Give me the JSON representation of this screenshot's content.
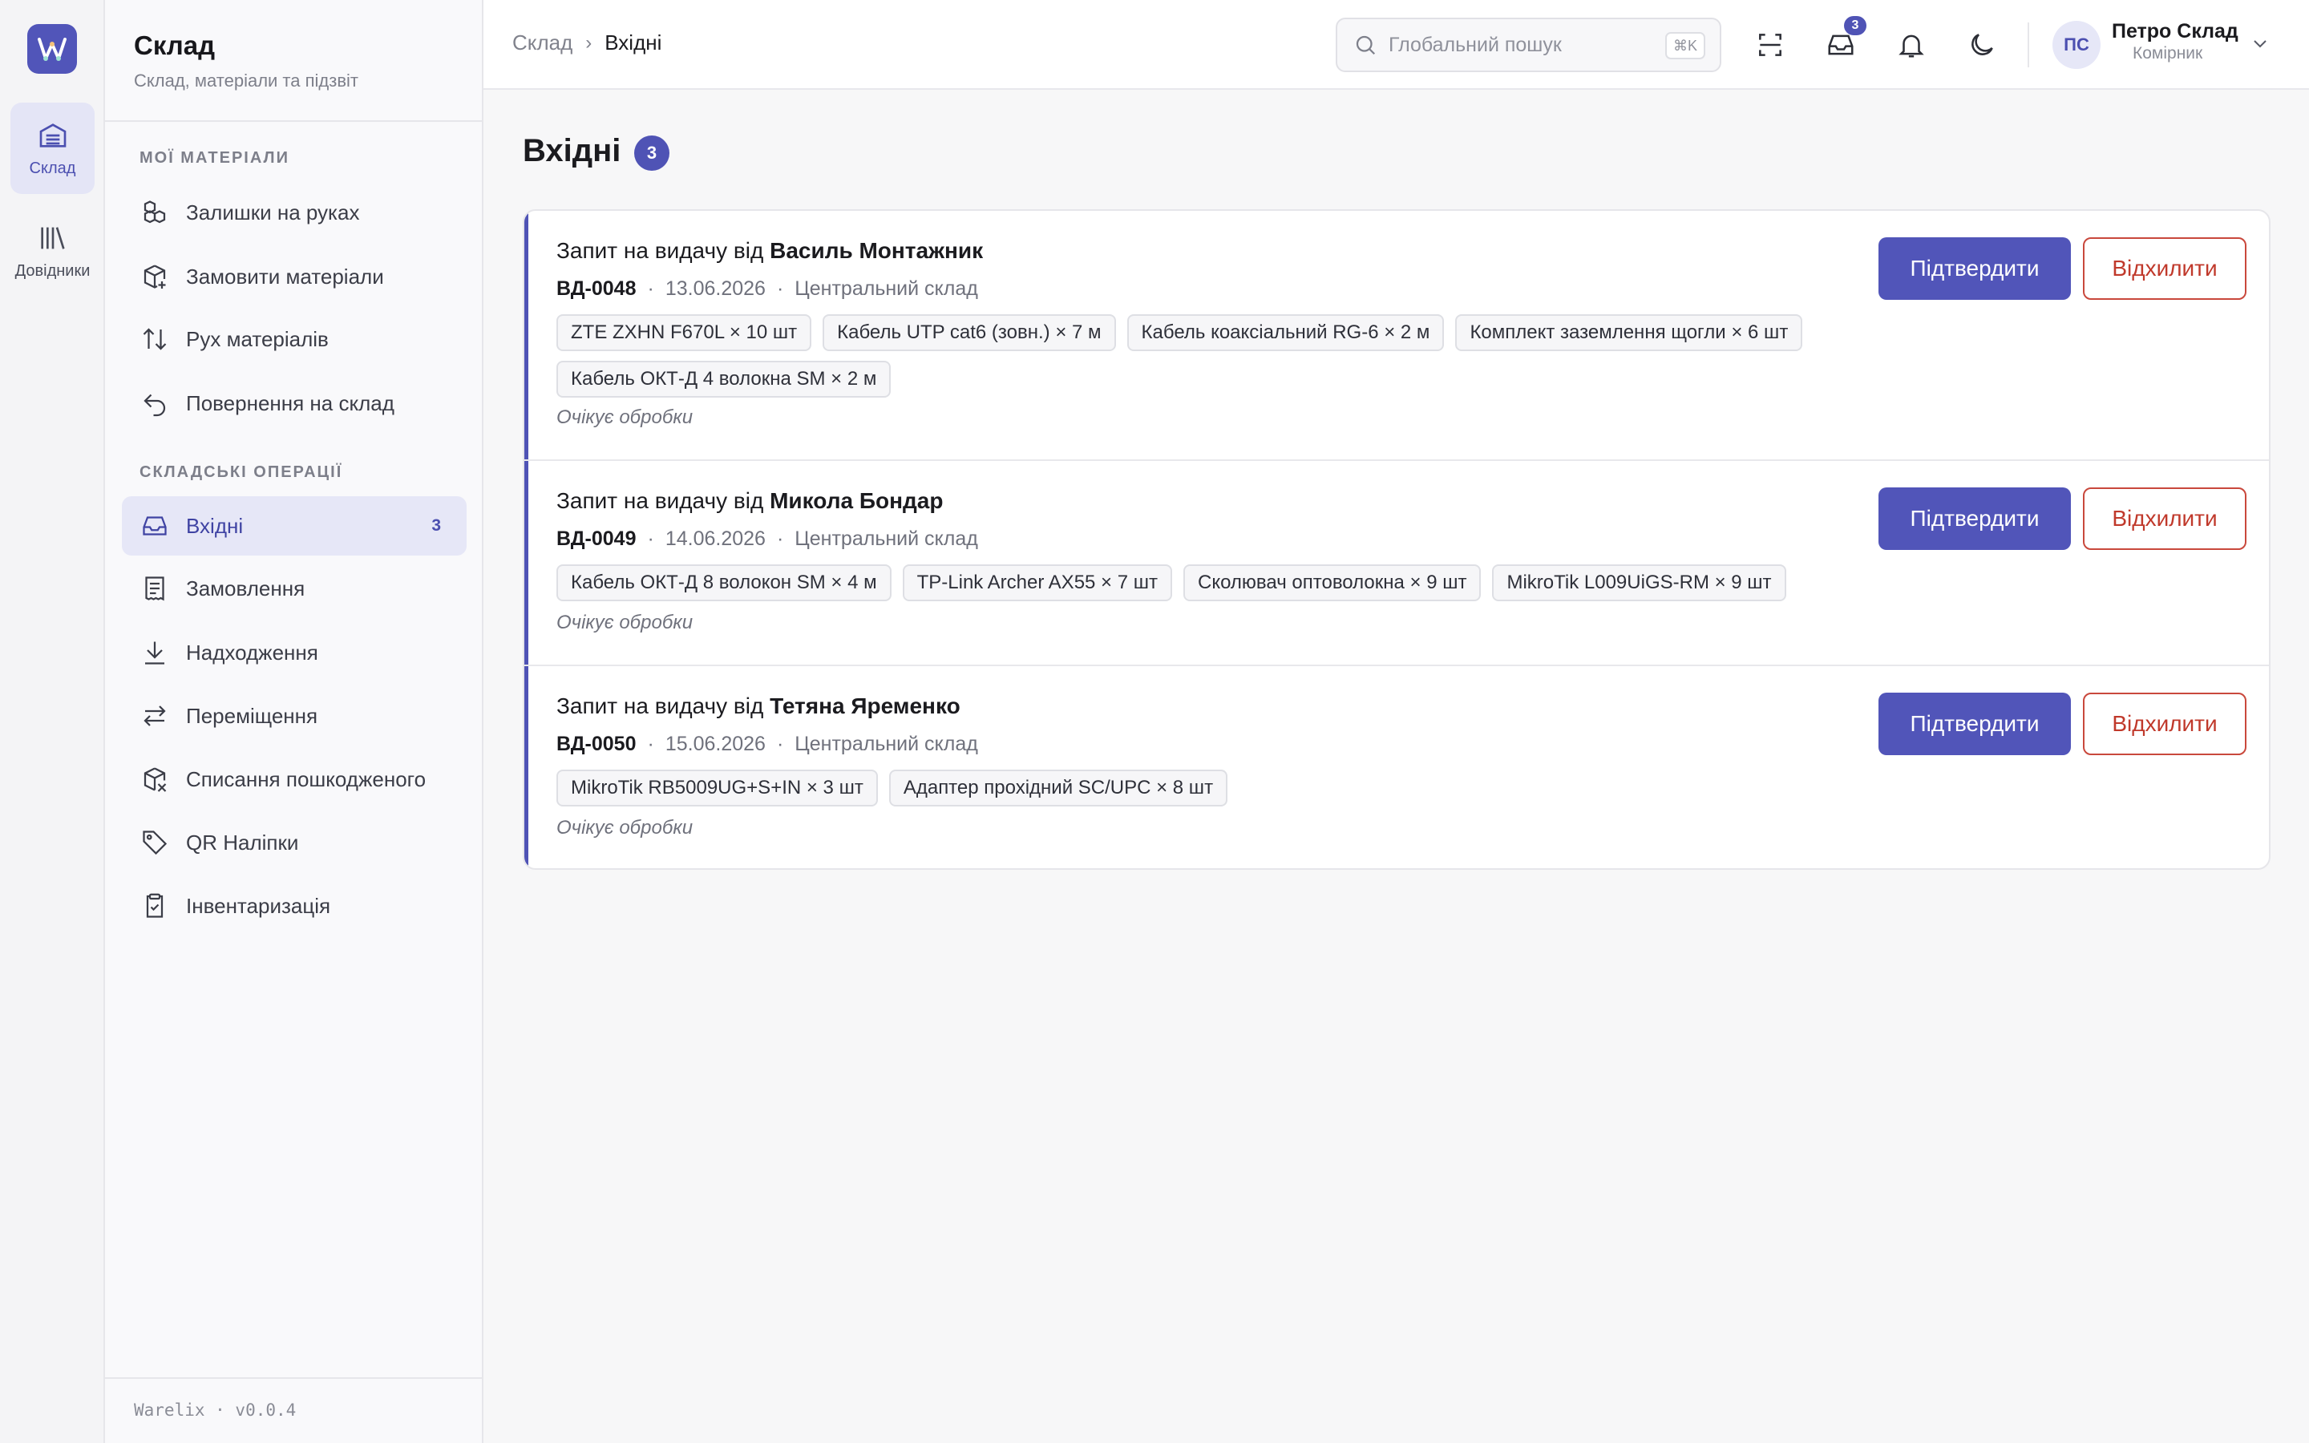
{
  "rail": {
    "items": [
      {
        "label": "Склад",
        "icon": "warehouse-icon"
      },
      {
        "label": "Довідники",
        "icon": "library-icon"
      }
    ]
  },
  "sidebar": {
    "title": "Склад",
    "subtitle": "Склад, матеріали та підзвіт",
    "sections": [
      {
        "label": "МОЇ МАТЕРІАЛИ"
      },
      {
        "label": "СКЛАДСЬКІ ОПЕРАЦІЇ"
      }
    ],
    "items": [
      {
        "label": "Залишки на руках",
        "icon": "boxes-icon"
      },
      {
        "label": "Замовити матеріали",
        "icon": "package-plus-icon"
      },
      {
        "label": "Рух матеріалів",
        "icon": "arrows-up-down-icon"
      },
      {
        "label": "Повернення на склад",
        "icon": "undo-icon"
      },
      {
        "label": "Вхідні",
        "icon": "inbox-icon",
        "count": "3",
        "active": true
      },
      {
        "label": "Замовлення",
        "icon": "receipt-icon"
      },
      {
        "label": "Надходження",
        "icon": "download-icon"
      },
      {
        "label": "Переміщення",
        "icon": "transfer-icon"
      },
      {
        "label": "Списання пошкодженого",
        "icon": "package-x-icon"
      },
      {
        "label": "QR Наліпки",
        "icon": "tag-icon"
      },
      {
        "label": "Інвентаризація",
        "icon": "clipboard-check-icon"
      }
    ],
    "footer": "Warelix · v0.0.4"
  },
  "topbar": {
    "breadcrumb": {
      "parent": "Склад",
      "separator": "›",
      "current": "Вхідні"
    },
    "search": {
      "placeholder": "Глобальний пошук",
      "shortcut": "⌘K"
    },
    "inbox_badge": "3",
    "user": {
      "initials": "ПС",
      "name": "Петро Склад",
      "role": "Комірник"
    }
  },
  "main": {
    "title": "Вхідні",
    "count": "3",
    "requests": [
      {
        "title_prefix": "Запит на видачу від",
        "requester": "Василь Монтажник",
        "code": "ВД-0048",
        "date": "13.06.2026",
        "warehouse": "Центральний склад",
        "items": [
          "ZTE ZXHN F670L × 10 шт",
          "Кабель UTP cat6 (зовн.) × 7 м",
          "Кабель коаксіальний RG-6 × 2 м",
          "Комплект заземлення щогли × 6 шт",
          "Кабель ОКТ-Д 4 волокна SM × 2 м"
        ],
        "status": "Очікує обробки",
        "confirm_label": "Підтвердити",
        "reject_label": "Відхилити"
      },
      {
        "title_prefix": "Запит на видачу від",
        "requester": "Микола Бондар",
        "code": "ВД-0049",
        "date": "14.06.2026",
        "warehouse": "Центральний склад",
        "items": [
          "Кабель ОКТ-Д 8 волокон SM × 4 м",
          "TP-Link Archer AX55 × 7 шт",
          "Сколювач оптоволокна × 9 шт",
          "MikroTik L009UiGS-RM × 9 шт"
        ],
        "status": "Очікує обробки",
        "confirm_label": "Підтвердити",
        "reject_label": "Відхилити"
      },
      {
        "title_prefix": "Запит на видачу від",
        "requester": "Тетяна Яременко",
        "code": "ВД-0050",
        "date": "15.06.2026",
        "warehouse": "Центральний склад",
        "items": [
          "MikroTik RB5009UG+S+IN × 3 шт",
          "Адаптер прохідний SC/UPC × 8 шт"
        ],
        "status": "Очікує обробки",
        "confirm_label": "Підтвердити",
        "reject_label": "Відхилити"
      }
    ]
  },
  "colors": {
    "accent": "#5155b9",
    "reject": "#c0392b",
    "active_bg": "#e6e7f7"
  }
}
